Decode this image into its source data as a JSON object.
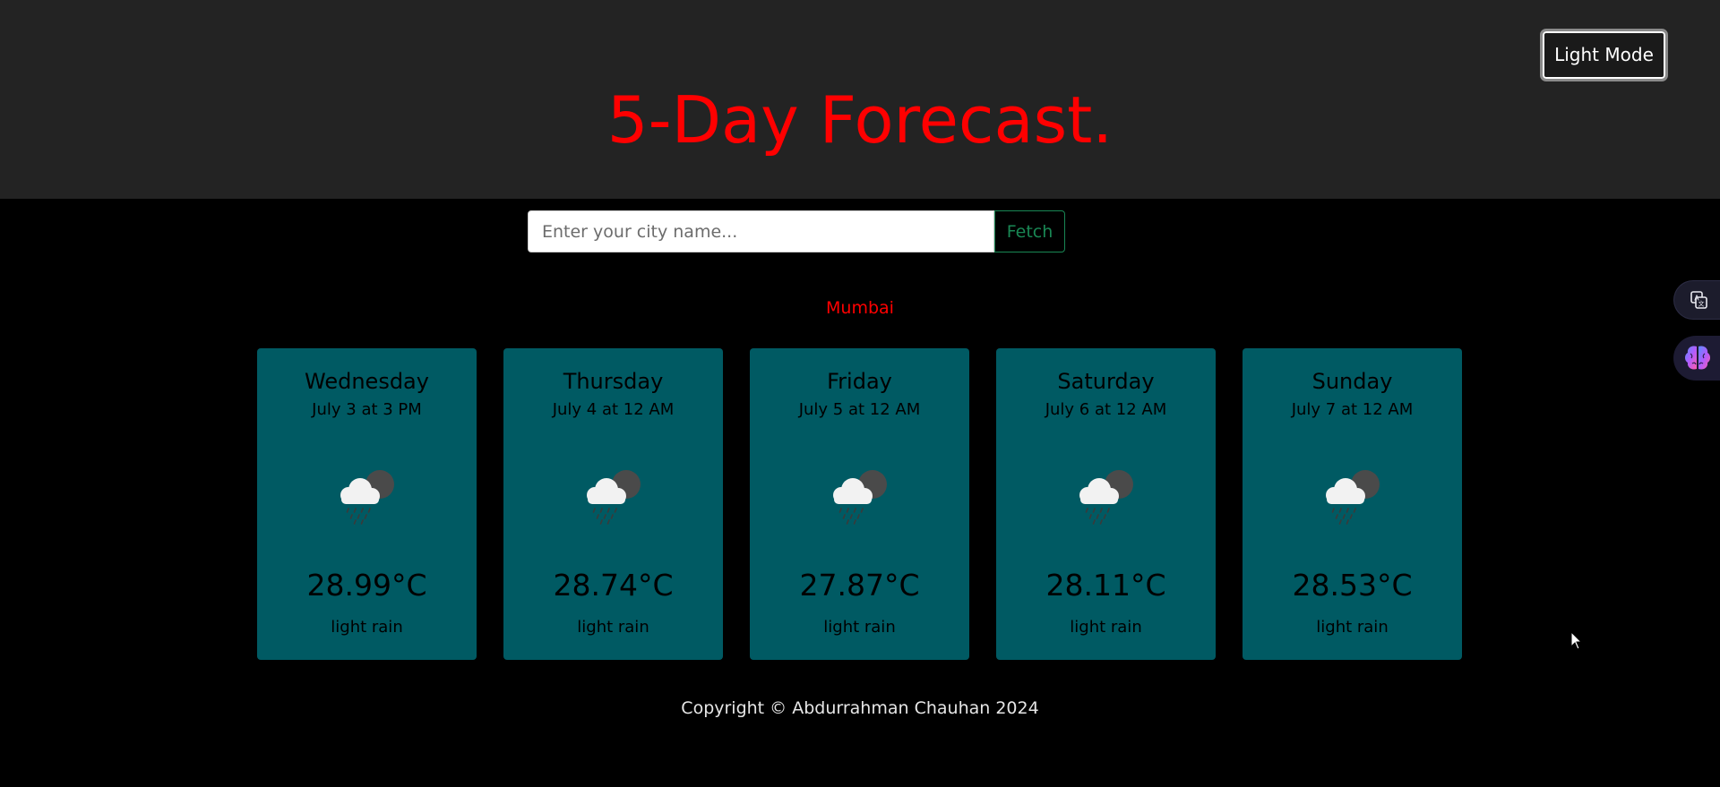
{
  "header": {
    "title": "5-Day Forecast.",
    "mode_button_label": "Light Mode"
  },
  "search": {
    "placeholder": "Enter your city name...",
    "value": "",
    "button_label": "Fetch"
  },
  "city": "Mumbai",
  "forecast": [
    {
      "day": "Wednesday",
      "date": "July 3 at 3 PM",
      "icon": "rain-cloud-icon",
      "temp": "28.99°C",
      "description": "light rain"
    },
    {
      "day": "Thursday",
      "date": "July 4 at 12 AM",
      "icon": "rain-cloud-icon",
      "temp": "28.74°C",
      "description": "light rain"
    },
    {
      "day": "Friday",
      "date": "July 5 at 12 AM",
      "icon": "rain-cloud-icon",
      "temp": "27.87°C",
      "description": "light rain"
    },
    {
      "day": "Saturday",
      "date": "July 6 at 12 AM",
      "icon": "rain-cloud-icon",
      "temp": "28.11°C",
      "description": "light rain"
    },
    {
      "day": "Sunday",
      "date": "July 7 at 12 AM",
      "icon": "rain-cloud-icon",
      "temp": "28.53°C",
      "description": "light rain"
    }
  ],
  "footer": {
    "copyright": "Copyright © Abdurrahman Chauhan 2024"
  },
  "side_widgets": {
    "translate_icon": "translate-icon",
    "brain_icon": "brain-icon"
  },
  "colors": {
    "title": "#ff0000",
    "card_background": "#005a63",
    "header_background": "#232323",
    "page_background": "#000000",
    "fetch_button": "#198754"
  }
}
